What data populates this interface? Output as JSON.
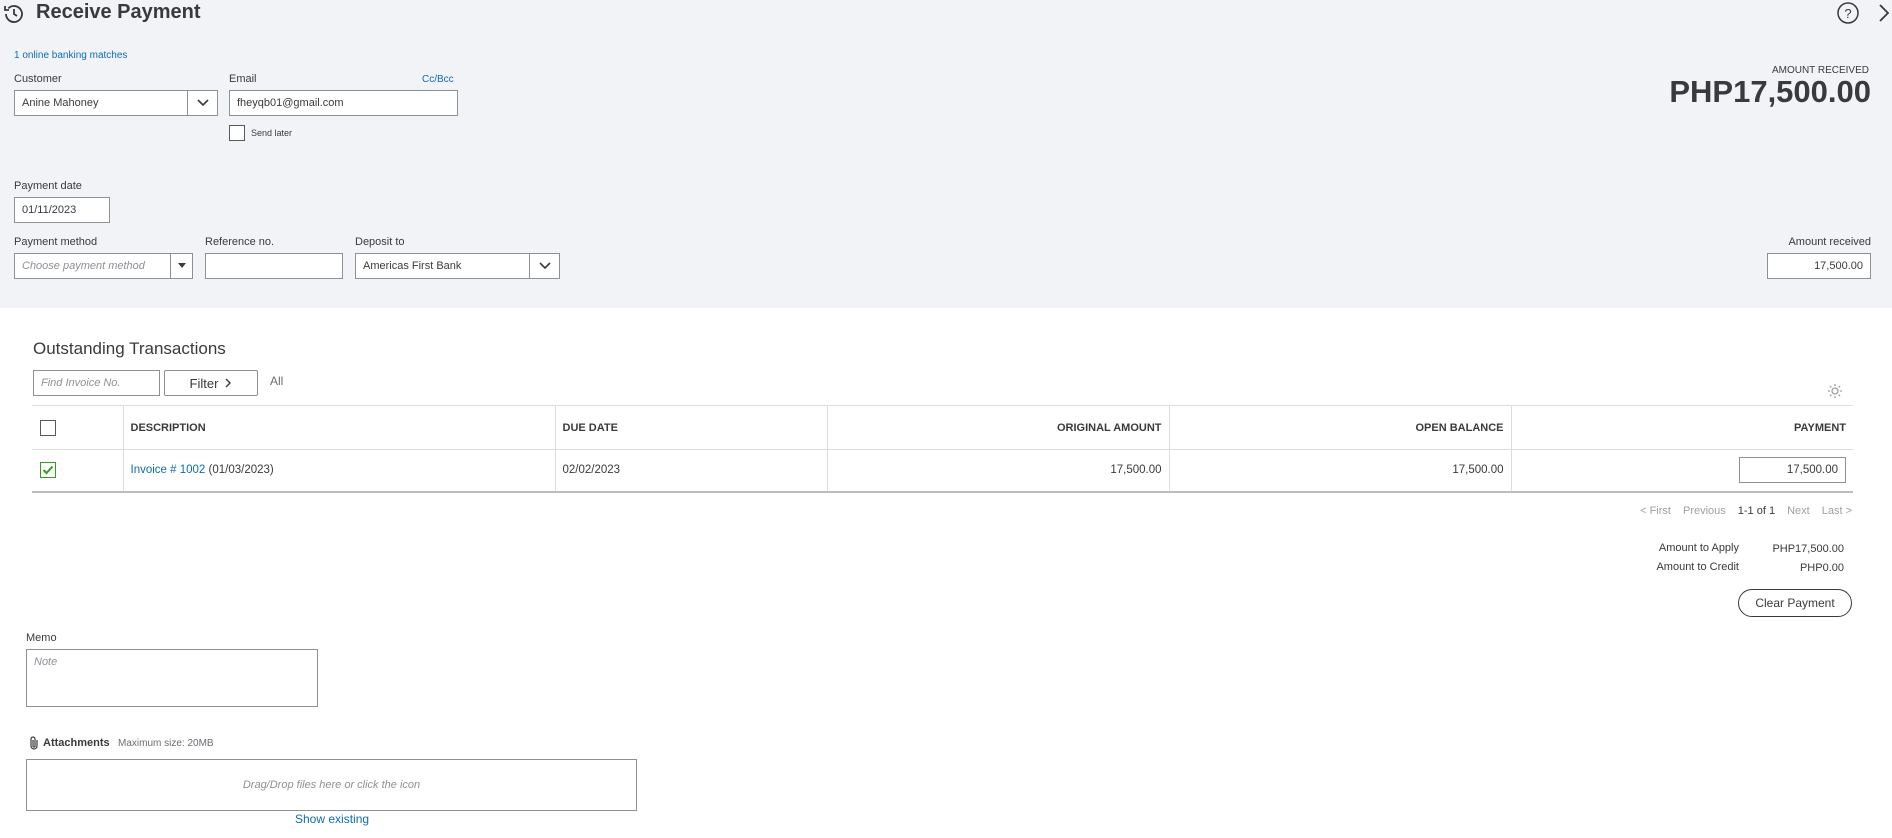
{
  "header": {
    "title": "Receive Payment",
    "banking_matches": "1 online banking matches"
  },
  "customer": {
    "label": "Customer",
    "value": "Anine Mahoney"
  },
  "email": {
    "label": "Email",
    "value": "fheyqb01@gmail.com",
    "cc_bcc": "Cc/Bcc",
    "send_later": "Send later",
    "send_later_checked": false
  },
  "amount_received_top": {
    "label": "AMOUNT RECEIVED",
    "value": "PHP17,500.00"
  },
  "payment_date": {
    "label": "Payment date",
    "value": "01/11/2023"
  },
  "payment_method": {
    "label": "Payment method",
    "placeholder": "Choose payment method"
  },
  "reference": {
    "label": "Reference no.",
    "value": ""
  },
  "deposit_to": {
    "label": "Deposit to",
    "value": "Americas First Bank"
  },
  "amount_received_field": {
    "label": "Amount received",
    "value": "17,500.00"
  },
  "outstanding": {
    "title": "Outstanding Transactions",
    "search_placeholder": "Find Invoice No.",
    "filter_label": "Filter",
    "filter_value": "All",
    "columns": [
      "DESCRIPTION",
      "DUE DATE",
      "ORIGINAL AMOUNT",
      "OPEN BALANCE",
      "PAYMENT"
    ],
    "rows": [
      {
        "checked": true,
        "invoice_link": "Invoice # 1002",
        "invoice_date": "(01/03/2023)",
        "due_date": "02/02/2023",
        "original_amount": "17,500.00",
        "open_balance": "17,500.00",
        "payment": "17,500.00"
      }
    ],
    "pager": {
      "first": "< First",
      "previous": "Previous",
      "range": "1-1 of 1",
      "next": "Next",
      "last": "Last >"
    }
  },
  "summary": {
    "apply_label": "Amount to Apply",
    "apply_value": "PHP17,500.00",
    "credit_label": "Amount to Credit",
    "credit_value": "PHP0.00",
    "clear_button": "Clear Payment"
  },
  "memo": {
    "label": "Memo",
    "placeholder": "Note"
  },
  "attachments": {
    "label": "Attachments",
    "max_size": "Maximum size: 20MB",
    "drop_text": "Drag/Drop files here or click the icon",
    "show_existing": "Show existing"
  },
  "colors": {
    "link": "#0d6db0",
    "check_green": "#2ca01c",
    "header_bg": "#f2f3f7"
  }
}
